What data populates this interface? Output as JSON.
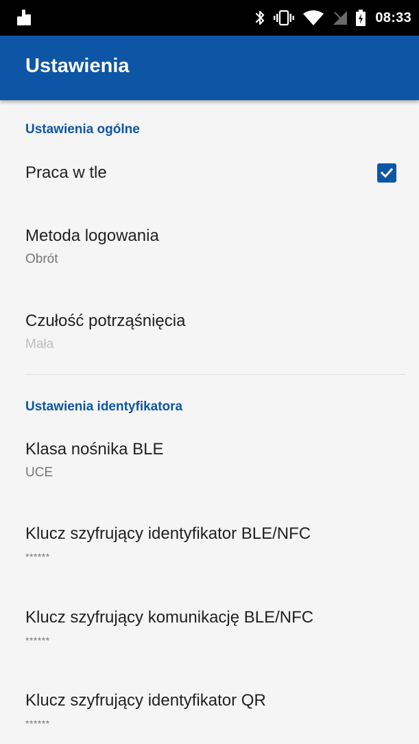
{
  "status_bar": {
    "time": "08:33",
    "icons": [
      "app-notification-icon",
      "bluetooth-icon",
      "vibrate-icon",
      "wifi-icon",
      "no-sim-icon",
      "battery-charging-icon"
    ]
  },
  "app_bar": {
    "title": "Ustawienia"
  },
  "sections": [
    {
      "header": "Ustawienia ogólne",
      "items": [
        {
          "title": "Praca w tle",
          "checked": true
        },
        {
          "title": "Metoda logowania",
          "value": "Obrót"
        },
        {
          "title": "Czułość potrząśnięcia",
          "value": "Mała",
          "disabled": true
        }
      ]
    },
    {
      "header": "Ustawienia identyfikatora",
      "items": [
        {
          "title": "Klasa nośnika BLE",
          "value": "UCE"
        },
        {
          "title": "Klucz szyfrujący identyfikator BLE/NFC",
          "value": "******"
        },
        {
          "title": "Klucz szyfrujący komunikację BLE/NFC",
          "value": "******"
        },
        {
          "title": "Klucz szyfrujący identyfikator QR",
          "value": "******"
        }
      ]
    }
  ],
  "colors": {
    "app_bar": "#0d56a5",
    "accent": "#0d56a5",
    "background": "#f5f5f5",
    "status_bar": "#000000"
  }
}
